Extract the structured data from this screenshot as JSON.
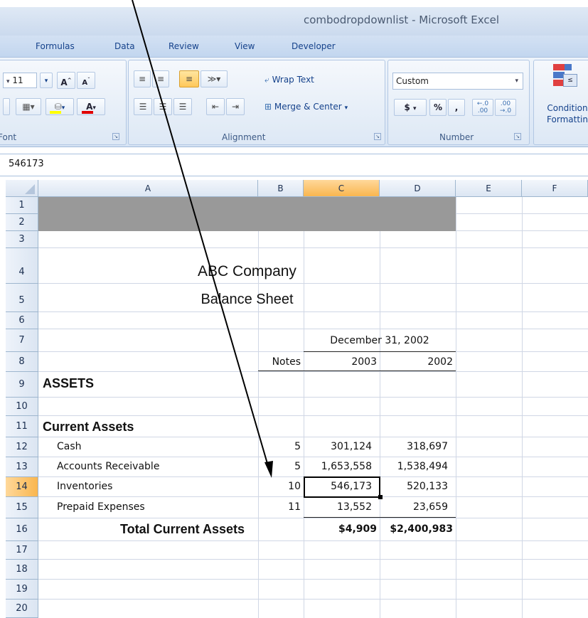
{
  "window": {
    "title": "combodropdownlist - Microsoft Excel"
  },
  "tabs": [
    "Formulas",
    "Data",
    "Review",
    "View",
    "Developer"
  ],
  "ribbon": {
    "font": {
      "size": "11",
      "group_label": "Font"
    },
    "alignment": {
      "wrap_text": "Wrap Text",
      "merge_center": "Merge & Center",
      "group_label": "Alignment"
    },
    "number": {
      "format": "Custom",
      "currency": "$",
      "percent": "%",
      "comma": ",",
      "inc_decimal": "←.0\n.00",
      "group_label": "Number"
    },
    "styles": {
      "conditional_formatting": "Condition Formattin"
    }
  },
  "formula_bar": {
    "value": "546173"
  },
  "grid": {
    "columns": [
      "A",
      "B",
      "C",
      "D",
      "E",
      "F"
    ],
    "selected_column": "C",
    "rows": [
      "1",
      "2",
      "3",
      "4",
      "5",
      "6",
      "7",
      "8",
      "9",
      "10",
      "11",
      "12",
      "13",
      "14",
      "15",
      "16",
      "17",
      "18",
      "19",
      "20"
    ],
    "selected_row": "14",
    "cells": {
      "company": "ABC Company",
      "sheet_title": "Balance Sheet",
      "date_header": "December 31, 2002",
      "notes_header": "Notes",
      "year_2003": "2003",
      "year_2002": "2002",
      "assets": "ASSETS",
      "current_assets": "Current Assets",
      "total_label": "Total Current Assets"
    },
    "line_items": [
      {
        "label": "Cash",
        "note": "5",
        "c": "301,124",
        "d": "318,697"
      },
      {
        "label": "Accounts Receivable",
        "note": "5",
        "c": "1,653,558",
        "d": "1,538,494"
      },
      {
        "label": "Inventories",
        "note": "10",
        "c": "546,173",
        "d": "520,133"
      },
      {
        "label": "Prepaid Expenses",
        "note": "11",
        "c": "13,552",
        "d": "23,659"
      }
    ],
    "totals": {
      "c": "$4,909",
      "d": "$2,400,983"
    }
  },
  "colors": {
    "accent": "#15428b",
    "header_fill": "#999999",
    "selected_header": "#f9b64f"
  }
}
